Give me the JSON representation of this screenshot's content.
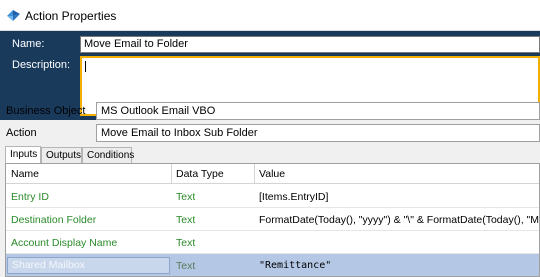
{
  "window": {
    "title": "Action Properties",
    "icon": "blueprism-action-icon"
  },
  "header": {
    "name_label": "Name:",
    "name_value": "Move Email to Folder",
    "description_label": "Description:",
    "description_value": ""
  },
  "business_object": {
    "label": "Business Object",
    "value": "MS Outlook Email VBO"
  },
  "action": {
    "label": "Action",
    "value": "Move Email to Inbox Sub Folder"
  },
  "tabs": [
    {
      "label": "Inputs",
      "active": true
    },
    {
      "label": "Outputs",
      "active": false
    },
    {
      "label": "Conditions",
      "active": false
    }
  ],
  "grid": {
    "columns": [
      "Name",
      "Data Type",
      "Value"
    ],
    "rows": [
      {
        "name": "Entry ID",
        "type": "Text",
        "value": "[Items.EntryID]",
        "selected": false
      },
      {
        "name": "Destination Folder",
        "type": "Text",
        "value": "FormatDate(Today(), \"yyyy\") & \"\\\" & FormatDate(Today(), \"MMMM\")",
        "selected": false
      },
      {
        "name": "Account Display Name",
        "type": "Text",
        "value": "",
        "selected": false
      },
      {
        "name": "Shared Mailbox",
        "type": "Text",
        "value": "\"Remittance\"",
        "selected": true
      }
    ]
  },
  "colors": {
    "header_bg": "#1a3a5c",
    "focus_border": "#f3b000",
    "selection": "#b4c8e6",
    "param_green": "#2a8a2a"
  }
}
